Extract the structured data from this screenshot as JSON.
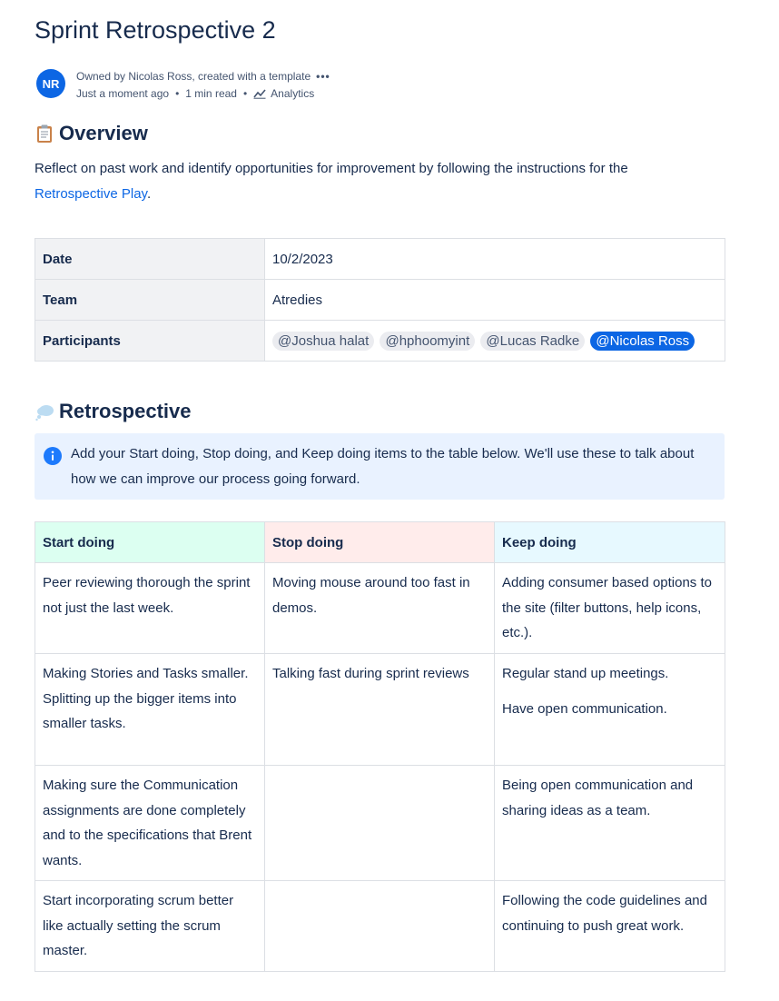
{
  "page": {
    "title": "Sprint Retrospective 2",
    "byline": {
      "avatar_initials": "NR",
      "owner_text": "Owned by Nicolas Ross, created with a template",
      "more_label": "•••",
      "updated": "Just a moment ago",
      "read_time": "1 min read",
      "analytics_label": "Analytics"
    }
  },
  "overview": {
    "heading": "Overview",
    "text": "Reflect on past work and identify opportunities for improvement by following the instructions for the",
    "link_text": "Retrospective Play",
    "trailing": "."
  },
  "meta_table": {
    "date_label": "Date",
    "date_value": "10/2/2023",
    "team_label": "Team",
    "team_value": "Atredies",
    "participants_label": "Participants",
    "participants": [
      "@Joshua halat",
      "@hphoomyint",
      "@Lucas Radke",
      "@Nicolas Ross"
    ]
  },
  "retrospective": {
    "heading": "Retrospective",
    "info_text": "Add your Start doing, Stop doing, and Keep doing items to the table below. We'll use these to talk about how we can improve our process going forward.",
    "columns": {
      "start": "Start doing",
      "stop": "Stop doing",
      "keep": "Keep doing"
    },
    "rows": [
      {
        "start": "Peer reviewing thorough the sprint not just the last week.",
        "stop": "Moving mouse around too fast in demos.",
        "keep": "Adding consumer based options to the site (filter buttons, help icons, etc.).",
        "keep2": ""
      },
      {
        "start": "Making Stories and Tasks smaller. Splitting up the bigger items into smaller tasks.",
        "stop": "Talking fast during sprint reviews",
        "keep": "Regular stand up meetings.",
        "keep2": "Have open communication."
      },
      {
        "start": "Making sure the Communication assignments are done completely and to the specifications that Brent wants.",
        "stop": "",
        "keep": "Being open communication and sharing ideas as a team.",
        "keep2": ""
      },
      {
        "start": "Start incorporating scrum better like actually setting the scrum master.",
        "stop": "",
        "keep": "Following the code guidelines and continuing to push great work.",
        "keep2": ""
      }
    ]
  },
  "colors": {
    "accent": "#0c66e4",
    "text": "#172b4d",
    "info_panel": "#e9f2ff",
    "start_header": "#dcfff1",
    "stop_header": "#ffeceb",
    "keep_header": "#e7f9ff"
  },
  "icons": [
    "clipboard-emoji-icon",
    "thought-balloon-emoji-icon",
    "info-icon",
    "analytics-icon",
    "more-icon"
  ]
}
